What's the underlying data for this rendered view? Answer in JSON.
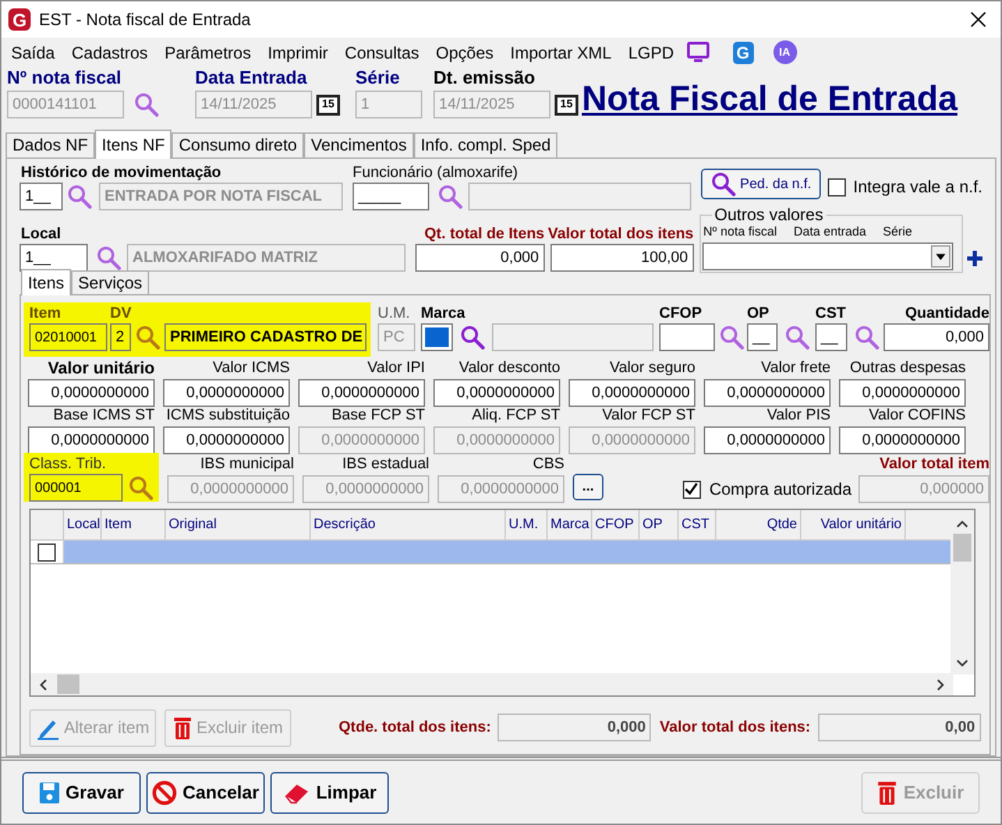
{
  "window": {
    "title": "EST - Nota fiscal de Entrada",
    "logo": "G"
  },
  "menu": [
    {
      "label": "Saída"
    },
    {
      "label": "Cadastros"
    },
    {
      "label": "Parâmetros"
    },
    {
      "label": "Imprimir"
    },
    {
      "label": "Consultas"
    },
    {
      "label": "Opções"
    },
    {
      "label": "Importar XML"
    },
    {
      "label": "LGPD"
    }
  ],
  "menu_badges": [
    "G",
    "IA"
  ],
  "header_fields": [
    {
      "label": "Nº nota fiscal",
      "value": "0000141101",
      "kind": "search",
      "required": true,
      "disabled": true
    },
    {
      "label": "Data Entrada",
      "value": "14/11/2025",
      "kind": "date",
      "calendar_button": "15",
      "required": true,
      "disabled": true
    },
    {
      "label": "Série",
      "value": "1",
      "kind": "text",
      "required": true,
      "disabled": true
    },
    {
      "label": "Dt. emissão",
      "value": "14/11/2025",
      "kind": "date",
      "calendar_button": "15",
      "required": false,
      "disabled": true
    }
  ],
  "page_heading": "Nota Fiscal de Entrada",
  "tabs": [
    {
      "label": "Dados NF",
      "selected": false
    },
    {
      "label": "Itens NF",
      "selected": true
    },
    {
      "label": "Consumo direto",
      "selected": false
    },
    {
      "label": "Vencimentos",
      "selected": false
    },
    {
      "label": "Info. compl. Sped",
      "selected": false
    }
  ],
  "itens_nf": {
    "historico": {
      "label": "Histórico de movimentação",
      "code": "1__",
      "description": "ENTRADA POR NOTA FISCAL"
    },
    "funcionario": {
      "label": "Funcionário (almoxarife)",
      "code": "_____"
    },
    "pedido_button": "Ped. da n.f.",
    "integra_vale": {
      "label": "Integra vale a n.f.",
      "checked": false
    },
    "local": {
      "label": "Local",
      "code": "1__",
      "description": "ALMOXARIFADO MATRIZ"
    },
    "qt_total": {
      "label": "Qt. total de Itens",
      "value": "0,000"
    },
    "valor_total": {
      "label": "Valor total dos itens",
      "value": "100,00"
    },
    "outros_valores": {
      "title": "Outros valores",
      "columns": [
        "Nº nota fiscal",
        "Data entrada",
        "Série"
      ]
    }
  },
  "inner_tabs": [
    {
      "label": "Itens",
      "selected": true
    },
    {
      "label": "Serviços",
      "selected": false
    }
  ],
  "item": {
    "highlighted": true,
    "item_label": "Item",
    "item_value": "02010001",
    "dv_label": "DV",
    "dv_value": "2",
    "description": "PRIMEIRO CADASTRO DE",
    "um_label": "U.M.",
    "um_value": "PC",
    "marca_label": "Marca",
    "cfop_label": "CFOP",
    "op_label": "OP",
    "op_value": "__",
    "cst_label": "CST",
    "cst_value": "__",
    "quantidade_label": "Quantidade",
    "quantidade_value": "0,000"
  },
  "value_rows": [
    [
      {
        "label": "Valor unitário",
        "value": "0,0000000000",
        "bold": true,
        "disabled": false
      },
      {
        "label": "Valor ICMS",
        "value": "0,0000000000",
        "bold": false,
        "disabled": false
      },
      {
        "label": "Valor IPI",
        "value": "0,0000000000",
        "bold": false,
        "disabled": false
      },
      {
        "label": "Valor desconto",
        "value": "0,0000000000",
        "bold": false,
        "disabled": false
      },
      {
        "label": "Valor seguro",
        "value": "0,0000000000",
        "bold": false,
        "disabled": false
      },
      {
        "label": "Valor frete",
        "value": "0,0000000000",
        "bold": false,
        "disabled": false
      },
      {
        "label": "Outras despesas",
        "value": "0,0000000000",
        "bold": false,
        "disabled": false
      }
    ],
    [
      {
        "label": "Base ICMS ST",
        "value": "0,0000000000",
        "bold": false,
        "disabled": false
      },
      {
        "label": "ICMS substituição",
        "value": "0,0000000000",
        "bold": false,
        "disabled": false
      },
      {
        "label": "Base FCP ST",
        "value": "0,0000000000",
        "bold": false,
        "disabled": true
      },
      {
        "label": "Aliq. FCP ST",
        "value": "0,0000000000",
        "bold": false,
        "disabled": true
      },
      {
        "label": "Valor FCP ST",
        "value": "0,0000000000",
        "bold": false,
        "disabled": true
      },
      {
        "label": "Valor PIS",
        "value": "0,0000000000",
        "bold": false,
        "disabled": false
      },
      {
        "label": "Valor COFINS",
        "value": "0,0000000000",
        "bold": false,
        "disabled": false
      }
    ]
  ],
  "class_row": {
    "class_trib": {
      "label": "Class. Trib.",
      "value": "000001",
      "highlighted": true
    },
    "fields": [
      {
        "label": "IBS municipal",
        "value": "0,0000000000",
        "disabled": true
      },
      {
        "label": "IBS estadual",
        "value": "0,0000000000",
        "disabled": true
      },
      {
        "label": "CBS",
        "value": "0,0000000000",
        "disabled": true
      }
    ],
    "more_button": "...",
    "compra_autorizada": {
      "label": "Compra autorizada",
      "checked": true
    },
    "valor_total_item": {
      "label": "Valor total item",
      "value": "0,000000",
      "disabled": true
    }
  },
  "grid": {
    "columns": [
      "Local",
      "Item",
      "Original",
      "Descrição",
      "U.M.",
      "Marca",
      "CFOP",
      "OP",
      "CST",
      "Qtde",
      "Valor unitário"
    ],
    "rows": [
      {
        "checked": false,
        "selected": true
      }
    ]
  },
  "item_buttons": [
    {
      "label": "Alterar item",
      "kind": "edit",
      "disabled": true
    },
    {
      "label": "Excluir item",
      "kind": "delete",
      "disabled": true
    }
  ],
  "totals": [
    {
      "label": "Qtde. total dos itens:",
      "value": "0,000"
    },
    {
      "label": "Valor total dos itens:",
      "value": "0,00"
    }
  ],
  "footer_buttons": [
    {
      "label": "Gravar",
      "kind": "save",
      "disabled": false
    },
    {
      "label": "Cancelar",
      "kind": "cancel",
      "disabled": false
    },
    {
      "label": "Limpar",
      "kind": "clear",
      "disabled": false
    },
    {
      "label": "Excluir",
      "kind": "delete",
      "disabled": true
    }
  ]
}
